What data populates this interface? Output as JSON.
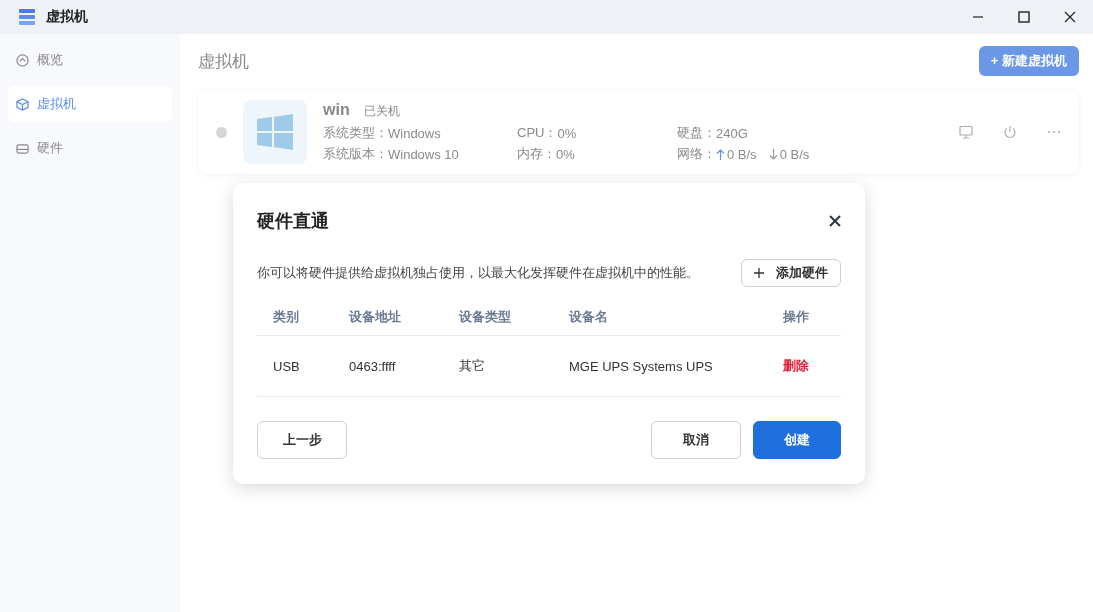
{
  "window": {
    "title": "虚拟机"
  },
  "sidebar": {
    "items": [
      {
        "label": "概览",
        "kind": "overview",
        "selected": false
      },
      {
        "label": "虚拟机",
        "kind": "vm",
        "selected": true
      },
      {
        "label": "硬件",
        "kind": "hardware",
        "selected": false
      }
    ]
  },
  "page": {
    "title": "虚拟机",
    "new_button": "+ 新建虚拟机"
  },
  "vms": [
    {
      "name": "win",
      "status": "已关机",
      "running": false,
      "fields": [
        {
          "label": "系统类型：",
          "value": "Windows"
        },
        {
          "label": "CPU：",
          "value": "0%"
        },
        {
          "label": "硬盘：",
          "value": "240G"
        },
        {
          "label": "系统版本：",
          "value": "Windows 10"
        },
        {
          "label": "内存：",
          "value": "0%"
        },
        {
          "label": "网络：",
          "up": "0 B/s",
          "down": "0 B/s"
        }
      ]
    }
  ],
  "dialog": {
    "title": "硬件直通",
    "description": "你可以将硬件提供给虚拟机独占使用，以最大化发挥硬件在虚拟机中的性能。",
    "add_button": "添加硬件",
    "table": {
      "columns": [
        "类别",
        "设备地址",
        "设备类型",
        "设备名",
        "操作"
      ],
      "rows": [
        {
          "cells": [
            "USB",
            "0463:ffff",
            "其它",
            "MGE UPS Systems UPS"
          ],
          "action": "删除"
        }
      ]
    },
    "buttons": {
      "back": "上一步",
      "cancel": "取消",
      "create": "创建"
    }
  }
}
